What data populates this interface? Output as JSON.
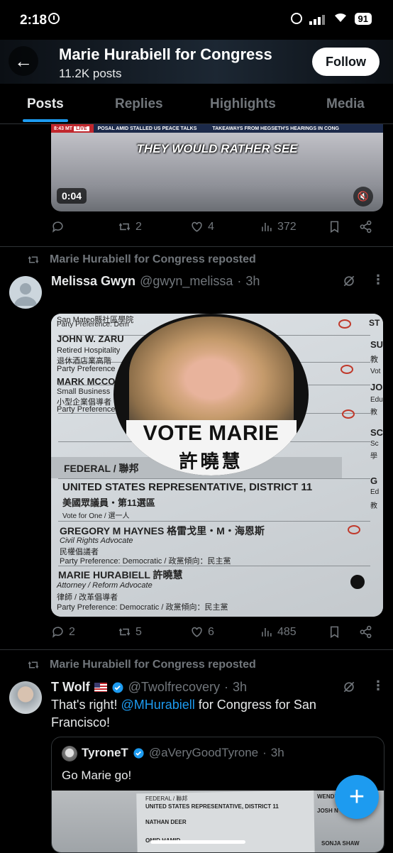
{
  "status_bar": {
    "time": "2:18",
    "battery": "91"
  },
  "header": {
    "title": "Marie Hurabiell for Congress",
    "posts_count": "11.2K posts",
    "follow_label": "Follow"
  },
  "tabs": [
    {
      "label": "Posts"
    },
    {
      "label": "Replies"
    },
    {
      "label": "Highlights"
    },
    {
      "label": "Media"
    }
  ],
  "video_post": {
    "ticker_time": "8:43 MT",
    "ticker_live": "LIVE",
    "ticker_text1": "POSAL AMID STALLED US PEACE TALKS",
    "ticker_text2": "TAKEAWAYS FROM HEGSETH'S HEARINGS IN CONG",
    "caption": "THEY WOULD RATHER SEE",
    "duration": "0:04",
    "actions": {
      "replies": "",
      "reposts": "2",
      "likes": "4",
      "views": "372"
    }
  },
  "post1": {
    "repost_label": "Marie Hurabiell for Congress reposted",
    "name": "Melissa Gwyn",
    "handle": "@gwyn_melissa",
    "time": "3h",
    "actions": {
      "replies": "2",
      "reposts": "5",
      "likes": "6",
      "views": "485"
    },
    "ballot": {
      "top_lines": [
        "San Mateo縣社區學院",
        "Party Preference: Dem",
        "JOHN W. ZARU",
        "Retired Hospitality",
        "退休酒店業高階",
        "Party Preference",
        "MARK MCCO",
        "Small Business",
        "小型企業倡導者",
        "Party Preference"
      ],
      "right_col": [
        "ST",
        "SU",
        "教",
        "Vot",
        "JO",
        "Edu",
        "教",
        "SC",
        "Sc",
        "學",
        "G",
        "Ed",
        "教"
      ],
      "section": "FEDERAL / 聯邦",
      "office": "UNITED STATES REPRESENTATIVE, DISTRICT 11",
      "office_zh": "美國眾議員・第11選區",
      "vote_for": "Vote for One / 選一人",
      "cand1_name": "GREGORY M HAYNES  格雷戈里・M・海恩斯",
      "cand1_occ": "Civil Rights Advocate",
      "cand1_occ_zh": "民權倡議者",
      "cand1_party": "Party Preference: Democratic / 政黨傾向：民主黨",
      "cand2_name": "MARIE HURABIELL  許曉慧",
      "cand2_occ": "Attorney / Reform Advocate",
      "cand2_occ_zh": "律師 / 改革倡導者",
      "cand2_party": "Party Preference: Democratic / 政黨傾向：民主黨",
      "button_line1": "VOTE MARIE",
      "button_line2": "許曉慧"
    }
  },
  "post2": {
    "repost_label": "Marie Hurabiell for Congress reposted",
    "name": "T Wolf",
    "handle": "@Twolfrecovery",
    "time": "3h",
    "text_before": "That's right! ",
    "mention": "@MHurabiell",
    "text_after": " for Congress for San Francisco!",
    "quote": {
      "name": "TyroneT",
      "handle": "@aVeryGoodTyrone",
      "time": "3h",
      "text": "Go Marie go!",
      "ballot_lines": [
        "FEDERAL / 聯邦",
        "UNITED STATES REPRESENTATIVE, DISTRICT 11",
        "NATHAN DEER",
        "OMID HAMID",
        "WENDY",
        "JOSH N",
        "SONJA SHAW"
      ]
    }
  },
  "colors": {
    "accent": "#1d9bf0",
    "text": "#e7e9ea",
    "muted": "#71767b",
    "divider": "#2f3336",
    "verified": "#1d9bf0"
  },
  "icons": [
    "back-arrow-icon",
    "reply-icon",
    "repost-icon",
    "like-icon",
    "views-icon",
    "bookmark-icon",
    "share-icon",
    "grok-icon",
    "more-icon",
    "verified-icon",
    "mute-icon",
    "compose-icon"
  ]
}
